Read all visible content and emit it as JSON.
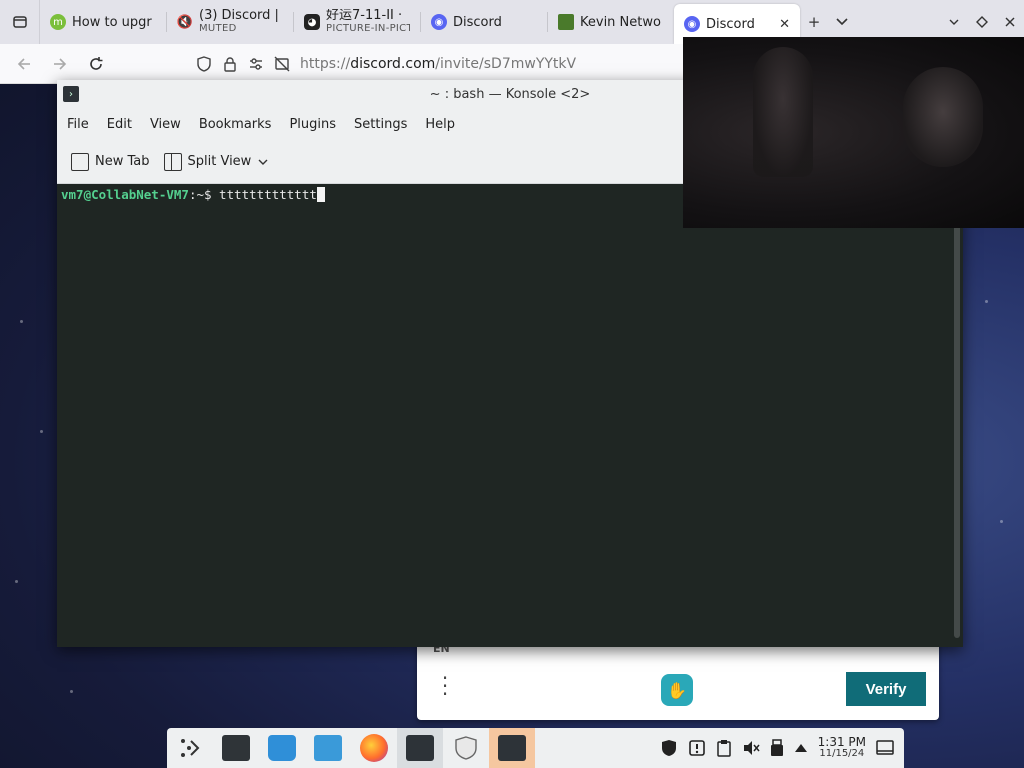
{
  "browser": {
    "tabs": [
      {
        "title": "How to upgr",
        "icon": "linux-mint-icon",
        "color": "#7bbf3b"
      },
      {
        "title": "(3) Discord |",
        "subtitle": "MUTED",
        "icon": "muted-speaker-icon",
        "color": "#5865f2"
      },
      {
        "title": "好运7-11-II ·",
        "subtitle": "PICTURE-IN-PICT",
        "icon": "cat-logo-icon",
        "color": "#222222"
      },
      {
        "title": "Discord",
        "icon": "discord-icon",
        "color": "#5865f2"
      },
      {
        "title": "Kevin Netwo",
        "icon": "minecraft-icon",
        "color": "#4a7a2b"
      },
      {
        "title": "Discord",
        "icon": "discord-icon",
        "color": "#5865f2",
        "active": true
      }
    ],
    "new_tab_label": "+",
    "url_prefix": "https://",
    "url_host": "discord.com",
    "url_path": "/invite/sD7mwYYtkV"
  },
  "konsole": {
    "title": "~ : bash — Konsole <2>",
    "menu": [
      "File",
      "Edit",
      "View",
      "Bookmarks",
      "Plugins",
      "Settings",
      "Help"
    ],
    "toolbar": {
      "new_tab": "New Tab",
      "split_view": "Split View"
    },
    "prompt_user": "vm7@CollabNet-VM7",
    "prompt_dir": ":~$ ",
    "command": "ttttttttttttt"
  },
  "discord_popup": {
    "lang": "EN",
    "verify_label": "Verify"
  },
  "taskbar": {
    "time": "1:31 PM",
    "date": "11/15/24"
  },
  "colors": {
    "verify_button": "#106c78",
    "prompt_green": "#54d08f",
    "terminal_bg": "#1f2623"
  }
}
